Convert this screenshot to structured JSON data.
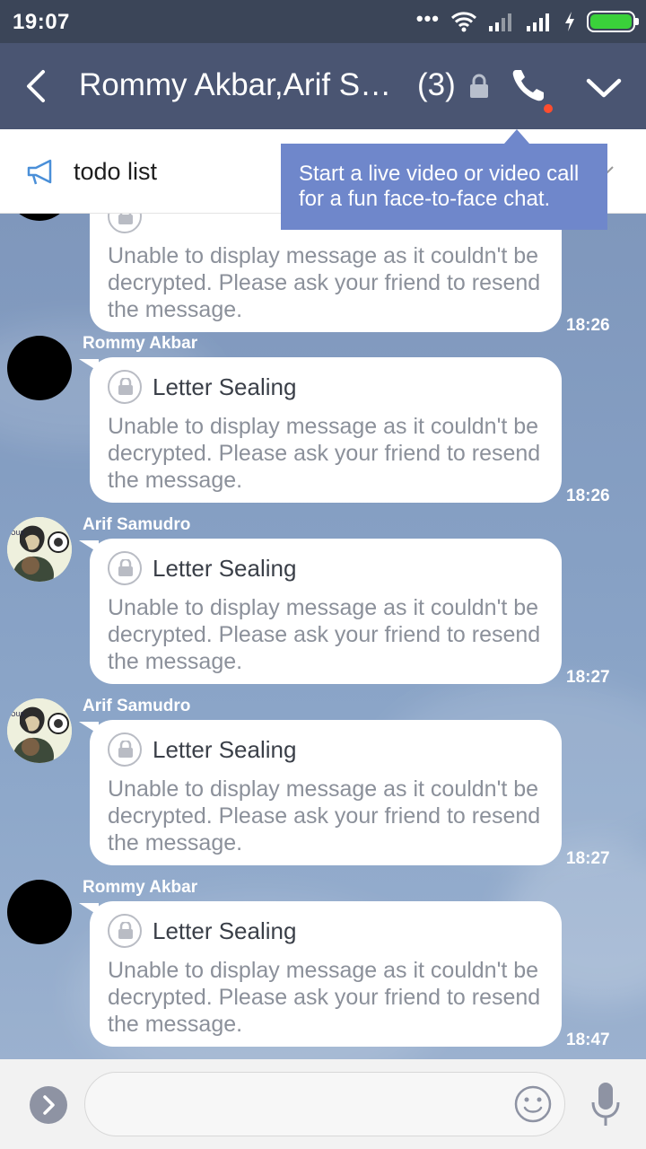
{
  "status_bar": {
    "time": "19:07",
    "icons": [
      "more-dots-icon",
      "wifi-icon",
      "signal-icon",
      "signal-icon",
      "charging-icon",
      "battery-icon"
    ],
    "dots": "•••"
  },
  "header": {
    "title": "Rommy Akbar,Arif Samudro",
    "member_count": "(3)",
    "icons": [
      "back-icon",
      "lock-icon",
      "phone-icon",
      "chevron-down-icon"
    ]
  },
  "note": {
    "text": "todo list",
    "icon": "megaphone-icon"
  },
  "tooltip": {
    "text": "Start a live video or video call for a fun face-to-face chat."
  },
  "messages": [
    {
      "sender": "",
      "avatar": "dark",
      "title": "",
      "body": "Unable to display message as it couldn't be decrypted. Please ask your friend to resend the message.",
      "time": "18:26"
    },
    {
      "sender": "Rommy Akbar",
      "avatar": "dark",
      "title": "Letter Sealing",
      "body": "Unable to display message as it couldn't be decrypted. Please ask your friend to resend the message.",
      "time": "18:26"
    },
    {
      "sender": "Arif Samudro",
      "avatar": "illustrated",
      "title": "Letter Sealing",
      "body": "Unable to display message as it couldn't be decrypted. Please ask your friend to resend the message.",
      "time": "18:27"
    },
    {
      "sender": "Arif Samudro",
      "avatar": "illustrated",
      "title": "Letter Sealing",
      "body": "Unable to display message as it couldn't be decrypted. Please ask your friend to resend the message.",
      "time": "18:27"
    },
    {
      "sender": "Rommy Akbar",
      "avatar": "dark",
      "title": "Letter Sealing",
      "body": "Unable to display message as it couldn't be decrypted. Please ask your friend to resend the message.",
      "time": "18:47"
    }
  ],
  "input_bar": {
    "value": "",
    "placeholder": "",
    "icons": [
      "expand-icon",
      "emoji-icon",
      "microphone-icon"
    ]
  },
  "colors": {
    "header_bg": "#4a5572",
    "status_bg": "#3b4558",
    "tooltip_bg": "#6f87cb",
    "chat_bg": "#86a0c4",
    "notification_dot": "#ff4d2e"
  }
}
